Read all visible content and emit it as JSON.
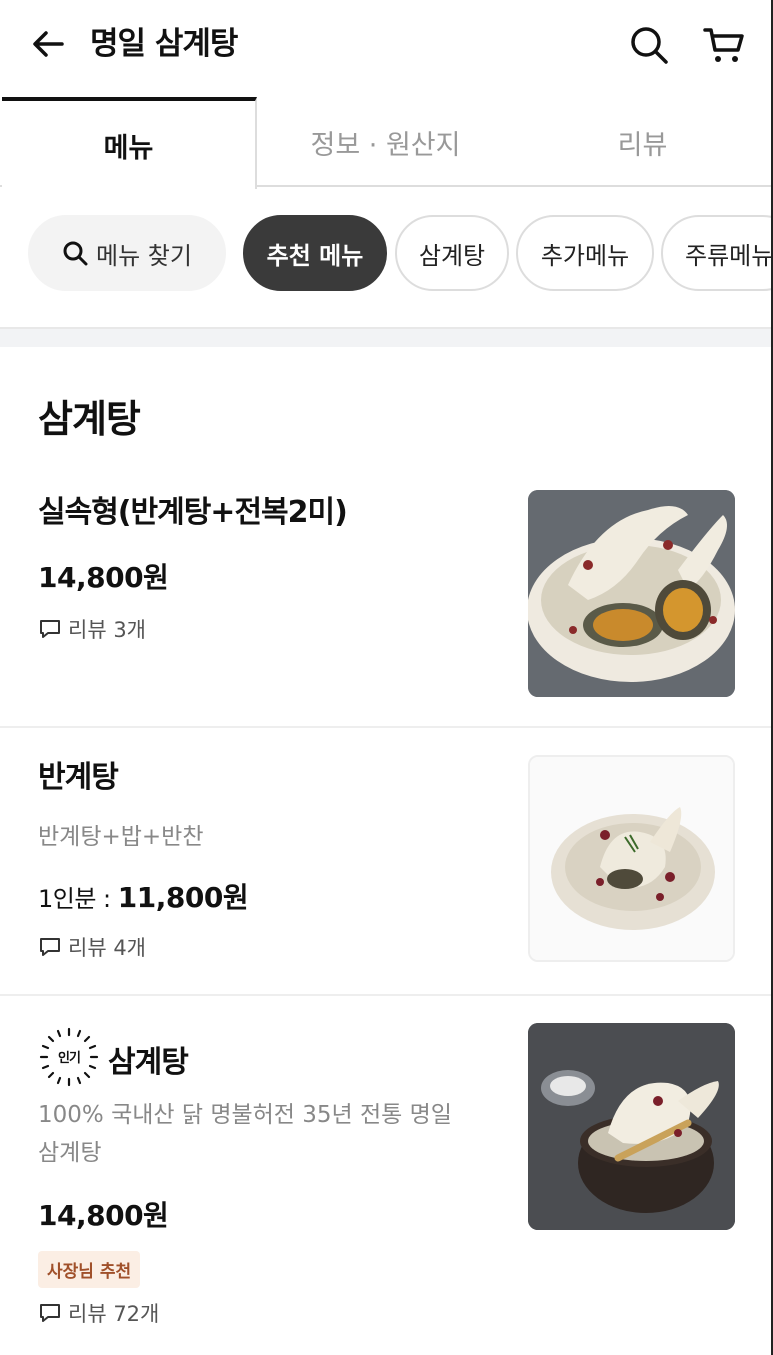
{
  "header": {
    "title": "명일 삼계탕",
    "back_icon": "arrow-left-icon",
    "search_icon": "search-icon",
    "cart_icon": "cart-icon"
  },
  "tabs": [
    {
      "label": "메뉴",
      "active": true
    },
    {
      "label": "정보 · 원산지",
      "active": false
    },
    {
      "label": "리뷰",
      "active": false
    }
  ],
  "chips": {
    "search_label": "메뉴 찾기",
    "items": [
      "추천 메뉴",
      "삼계탕",
      "추가메뉴",
      "주류메뉴"
    ]
  },
  "section": {
    "title": "삼계탕"
  },
  "menu": [
    {
      "name": "실속형(반계탕+전복2미)",
      "price": "14,800원",
      "review": "리뷰 3개"
    },
    {
      "name": "반계탕",
      "description": "반계탕+밥+반찬",
      "price_label": "1인분 : ",
      "price": "11,800원",
      "review": "리뷰 4개"
    },
    {
      "popular_badge": "인기",
      "name": "삼계탕",
      "description": "100% 국내산 닭 명불허전 35년 전통 명일 삼계탕",
      "price": "14,800원",
      "tag": "사장님 추천",
      "review": "리뷰 72개"
    }
  ],
  "colors": {
    "chip_active_bg": "#3a3a3a",
    "badge_bg": "#fbeee4",
    "badge_text": "#a0502a"
  }
}
